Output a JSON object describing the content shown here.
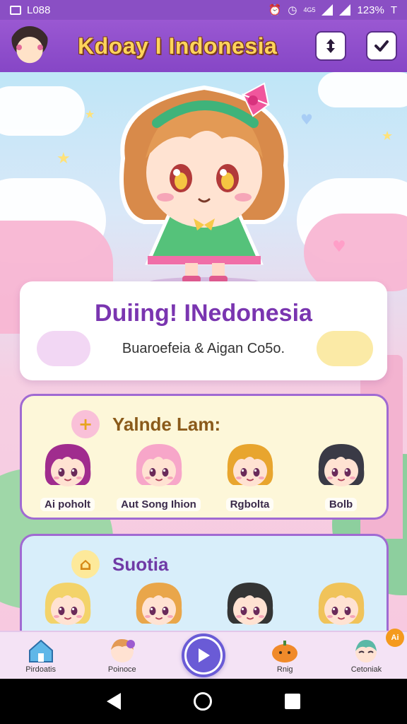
{
  "status_bar": {
    "time": "L088",
    "battery": "123%",
    "network_small": "4G5",
    "right_glyph": "T"
  },
  "header": {
    "title": "Kdoay I Indonesia",
    "left_action_icon": "swap-vertical-icon",
    "right_action_icon": "checkmark-icon"
  },
  "info_card": {
    "title": "Duiing! INedonesia",
    "subtitle": "Buaroefeia & Aigan Co5o."
  },
  "section_one": {
    "title": "Yalnde Lam:",
    "characters": [
      {
        "label": "Ai poholt",
        "hair": "#a02c8e",
        "skin": "#ffe2d2"
      },
      {
        "label": "Aut Song Ihion",
        "hair": "#f7a6c9",
        "skin": "#ffe2d2"
      },
      {
        "label": "Rgbolta",
        "hair": "#e8a52e",
        "skin": "#ffe2d2"
      },
      {
        "label": "Bolb",
        "hair": "#3a3a46",
        "skin": "#ffe2d2"
      }
    ]
  },
  "section_two": {
    "title": "Suotia",
    "characters": [
      {
        "label": "",
        "hair": "#f3d36a",
        "skin": "#ffe2d2"
      },
      {
        "label": "",
        "hair": "#e9a64a",
        "skin": "#ffe2d2"
      },
      {
        "label": "",
        "hair": "#343434",
        "skin": "#ffe2d2"
      },
      {
        "label": "",
        "hair": "#f0c35a",
        "skin": "#ffe2d2"
      }
    ]
  },
  "bottom_nav": {
    "items": [
      {
        "label": "Pirdoatis",
        "icon": "home-icon"
      },
      {
        "label": "Poinoce",
        "icon": "character-icon"
      },
      {
        "label": "",
        "icon": "play-icon"
      },
      {
        "label": "Rnig",
        "icon": "pumpkin-icon"
      },
      {
        "label": "Cetoniak",
        "icon": "character-icon"
      }
    ],
    "badge": "Ai"
  },
  "colors": {
    "header": "#8646c6",
    "title_yellow": "#ffd45a",
    "accent_purple": "#7a35b0",
    "play_button": "#6a5bd6"
  }
}
